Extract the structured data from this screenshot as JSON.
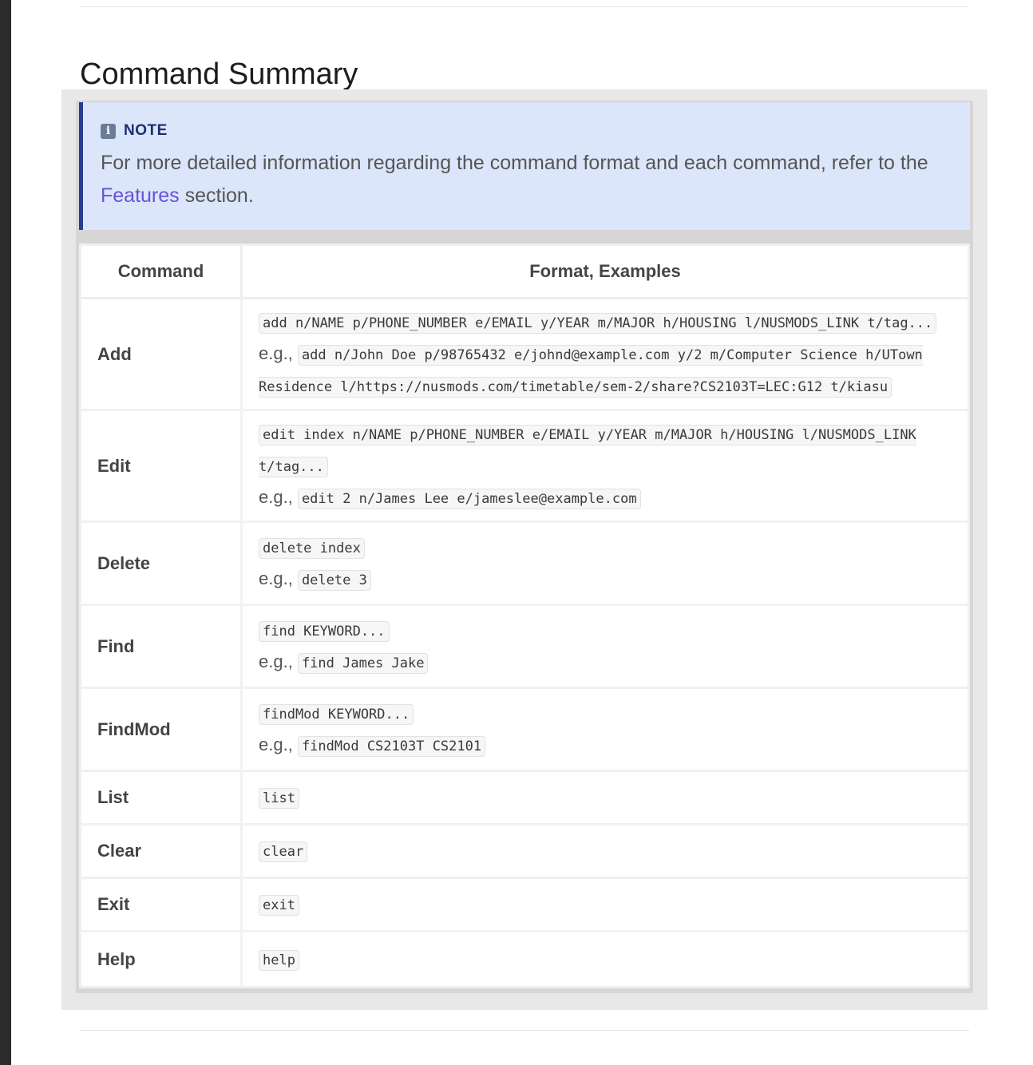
{
  "page": {
    "title": "Command Summary"
  },
  "note": {
    "label": "NOTE",
    "text_before": "For more detailed information regarding the command format and each command, refer to the ",
    "link": "Features",
    "text_after": " section."
  },
  "table": {
    "headers": [
      "Command",
      "Format, Examples"
    ],
    "eg_prefix": "e.g.,",
    "rows": [
      {
        "command": "Add",
        "format": "add n/NAME p/PHONE_NUMBER e/EMAIL y/YEAR m/MAJOR h/HOUSING l/NUSMODS_LINK t/tag...",
        "example": "add n/John Doe p/98765432 e/johnd@example.com y/2 m/Computer Science h/UTown Residence l/https://nusmods.com/timetable/sem-2/share?CS2103T=LEC:G12 t/kiasu"
      },
      {
        "command": "Edit",
        "format": "edit index n/NAME p/PHONE_NUMBER e/EMAIL y/YEAR m/MAJOR h/HOUSING l/NUSMODS_LINK t/tag...",
        "example": "edit 2 n/James Lee e/jameslee@example.com"
      },
      {
        "command": "Delete",
        "format": "delete index",
        "example": "delete 3"
      },
      {
        "command": "Find",
        "format": "find KEYWORD...",
        "example": "find James Jake"
      },
      {
        "command": "FindMod",
        "format": "findMod KEYWORD...",
        "example": "findMod CS2103T CS2101"
      },
      {
        "command": "List",
        "format": "list"
      },
      {
        "command": "Clear",
        "format": "clear"
      },
      {
        "command": "Exit",
        "format": "exit"
      },
      {
        "command": "Help",
        "format": "help"
      }
    ]
  },
  "colors": {
    "note_bg": "#dbe6fa",
    "note_border": "#283b8e",
    "link": "#6a4fd8"
  },
  "icons": {
    "note_icon": "info-icon"
  }
}
